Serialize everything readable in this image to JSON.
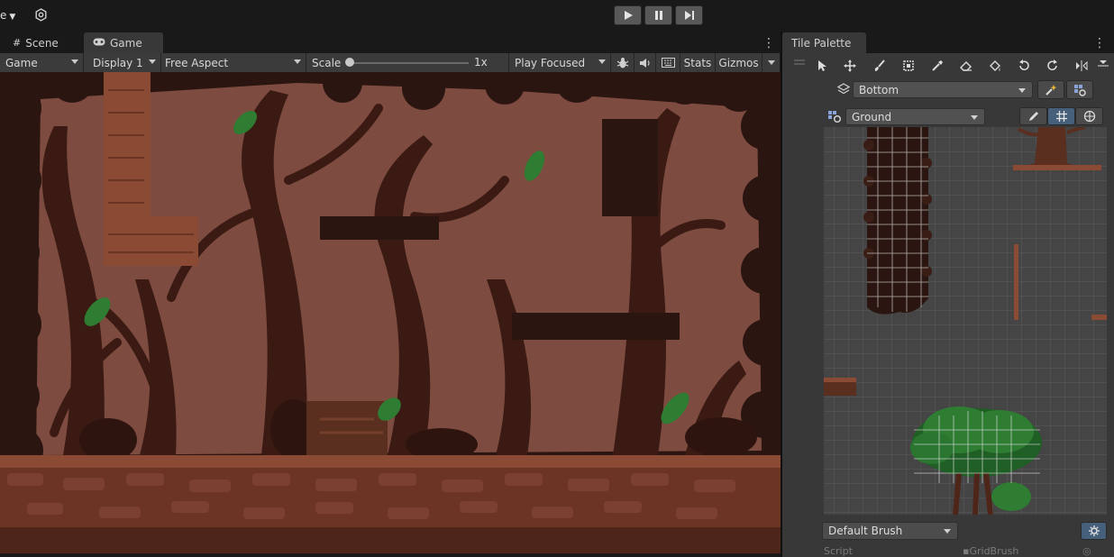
{
  "topbar": {
    "layout_label": "e",
    "playmode": {
      "play_icon": "play-icon",
      "pause_icon": "pause-icon",
      "step_icon": "step-icon"
    }
  },
  "left_tabs": [
    {
      "label": "Scene",
      "icon": "grid-icon",
      "active": false
    },
    {
      "label": "Game",
      "icon": "gamepad-icon",
      "active": true
    }
  ],
  "game_toolbar": {
    "view_select": "Game",
    "display": "Display 1",
    "aspect": "Free Aspect",
    "scale_label": "Scale",
    "scale_value": "1x",
    "scale_level": 0.0,
    "play_mode": "Play Focused",
    "stats_label": "Stats",
    "gizmos_label": "Gizmos"
  },
  "right_panel": {
    "tab_label": "Tile Palette",
    "tools": [
      "select-icon",
      "move-icon",
      "paint-icon",
      "box-fill-icon",
      "picker-icon",
      "erase-icon",
      "fill-icon",
      "rotate-ccw-icon",
      "rotate-cw-icon",
      "flip-x-icon",
      "flip-y-icon"
    ],
    "active_target": "Bottom",
    "palette": "Ground",
    "brush": "Default Brush",
    "script_label": "Script",
    "script_value": "GridBrush"
  },
  "colors": {
    "background_sky": "#7d4b3f",
    "dark_tree": "#2e140e",
    "ground_top": "#8a4a34",
    "leaf": "#2e7d32",
    "panel": "#383838",
    "toolbar": "#3b3b3b",
    "active_toggle": "#46607c"
  }
}
